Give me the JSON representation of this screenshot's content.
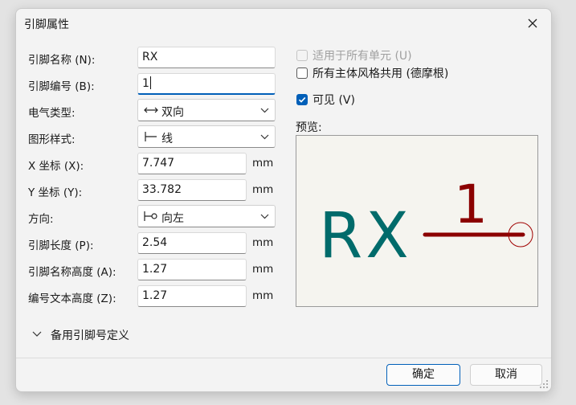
{
  "dialog": {
    "title": "引脚属性"
  },
  "fields": {
    "pin_name": {
      "label": "引脚名称 (N):",
      "value": "RX"
    },
    "pin_number": {
      "label": "引脚编号 (B):",
      "value": "1"
    },
    "electrical_type": {
      "label": "电气类型:",
      "value": "双向",
      "icon": "bidirectional-arrow-icon"
    },
    "graphic_style": {
      "label": "图形样式:",
      "value": "线",
      "icon": "line-style-icon"
    },
    "x_pos": {
      "label": "X 坐标 (X):",
      "value": "7.747",
      "unit": "mm"
    },
    "y_pos": {
      "label": "Y 坐标 (Y):",
      "value": "33.782",
      "unit": "mm"
    },
    "orientation": {
      "label": "方向:",
      "value": "向左",
      "icon": "pin-left-icon"
    },
    "pin_length": {
      "label": "引脚长度 (P):",
      "value": "2.54",
      "unit": "mm"
    },
    "name_size": {
      "label": "引脚名称高度 (A):",
      "value": "1.27",
      "unit": "mm"
    },
    "number_size": {
      "label": "编号文本高度 (Z):",
      "value": "1.27",
      "unit": "mm"
    }
  },
  "options": {
    "all_units": {
      "label": "适用于所有单元 (U)",
      "checked": false,
      "disabled": true
    },
    "all_body_styles": {
      "label": "所有主体风格共用 (德摩根)",
      "checked": false
    },
    "visible": {
      "label": "可见 (V)",
      "checked": true
    }
  },
  "preview": {
    "label": "预览:",
    "pin_name": "RX",
    "pin_number": "1",
    "colors": {
      "name": "#006b6b",
      "pin": "#8b0000",
      "background": "#f5f4ef"
    }
  },
  "alternates": {
    "label": "备用引脚号定义"
  },
  "buttons": {
    "ok": "确定",
    "cancel": "取消"
  },
  "colors": {
    "accent": "#005fb8"
  }
}
